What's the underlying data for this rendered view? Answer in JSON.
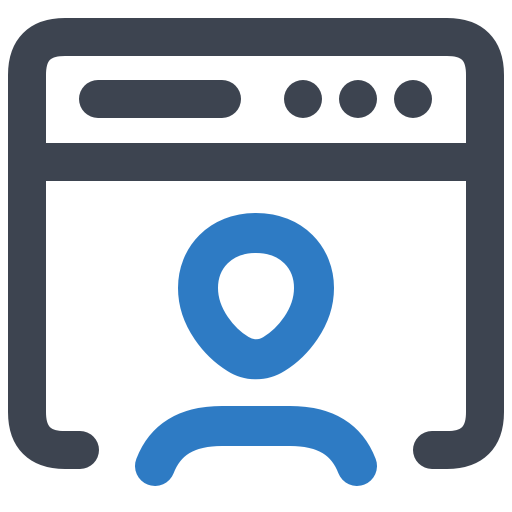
{
  "icon": {
    "name": "browser-user-profile-icon",
    "colors": {
      "frame": "#3d4450",
      "user": "#2e7bc4",
      "background": "#ffffff"
    }
  }
}
